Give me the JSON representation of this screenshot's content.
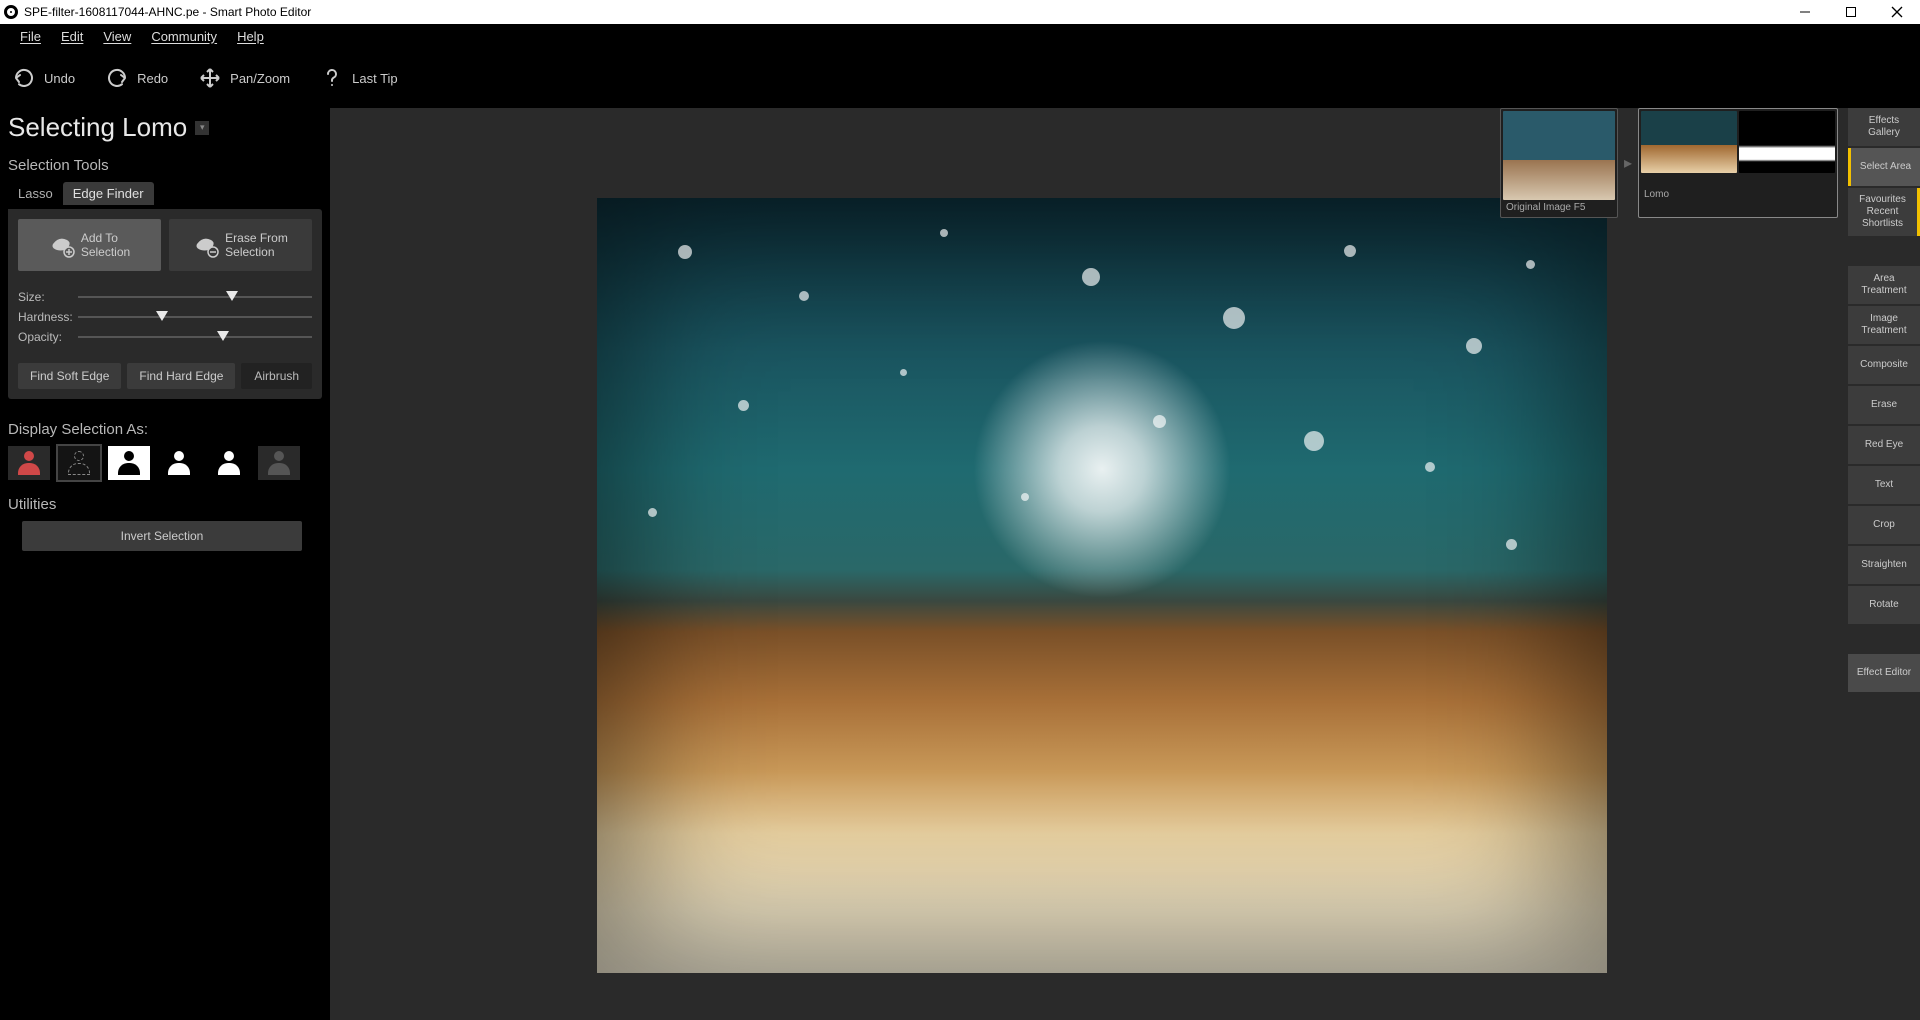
{
  "titlebar": {
    "title": "SPE-filter-1608117044-AHNC.pe - Smart Photo Editor"
  },
  "menu": {
    "file": "File",
    "edit": "Edit",
    "view": "View",
    "community": "Community",
    "help": "Help"
  },
  "toolbar": {
    "undo": "Undo",
    "redo": "Redo",
    "panzoom": "Pan/Zoom",
    "lasttip": "Last Tip"
  },
  "page": {
    "title": "Selecting Lomo"
  },
  "sections": {
    "tools": "Selection Tools",
    "display": "Display Selection As:",
    "utilities": "Utilities"
  },
  "tabs": {
    "lasso": "Lasso",
    "edgefinder": "Edge Finder"
  },
  "buttons": {
    "add": "Add To\nSelection",
    "erase": "Erase From\nSelection",
    "findsoft": "Find Soft Edge",
    "findhard": "Find Hard Edge",
    "airbrush": "Airbrush",
    "invert": "Invert Selection"
  },
  "sliders": {
    "size": {
      "label": "Size:",
      "value": 66
    },
    "hardness": {
      "label": "Hardness:",
      "value": 36
    },
    "opacity": {
      "label": "Opacity:",
      "value": 62
    }
  },
  "thumbs": {
    "original": "Original Image F5",
    "lomo": "Lomo"
  },
  "right": {
    "effects_gallery": "Effects Gallery",
    "select_area": "Select Area",
    "favourites": "Favourites Recent Shortlists",
    "area_treatment": "Area Treatment",
    "image_treatment": "Image Treatment",
    "composite": "Composite",
    "erase": "Erase",
    "redeye": "Red Eye",
    "text": "Text",
    "crop": "Crop",
    "straighten": "Straighten",
    "rotate": "Rotate",
    "effect_editor": "Effect Editor"
  }
}
